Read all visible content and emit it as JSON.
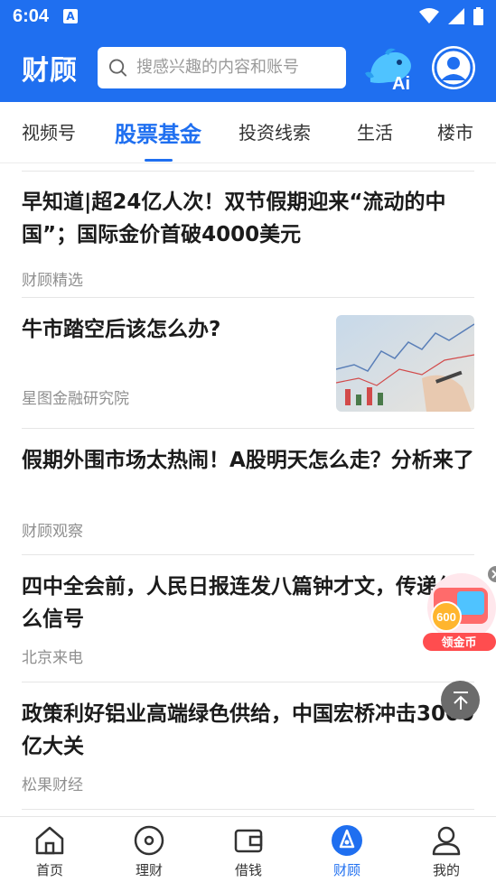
{
  "status_bar": {
    "time": "6:04",
    "a_badge": "A"
  },
  "header": {
    "brand": "财顾",
    "search_placeholder": "搜感兴趣的内容和账号",
    "ai_label": "Ai"
  },
  "tabs": [
    {
      "label": "视频号"
    },
    {
      "label": "股票基金",
      "active": true
    },
    {
      "label": "投资线索"
    },
    {
      "label": "生活"
    },
    {
      "label": "楼市"
    }
  ],
  "articles": [
    {
      "title": "早知道|超24亿人次！双节假期迎来“流动的中国”；国际金价首破4000美元",
      "source": "财顾精选"
    },
    {
      "title": "牛市踏空后该怎么办?",
      "source": "星图金融研究院",
      "has_thumbnail": true
    },
    {
      "title": "假期外围市场太热闹！A股明天怎么走？分析来了",
      "source": "财顾观察"
    },
    {
      "title": "四中全会前，人民日报连发八篇钟才文，传递什么信号",
      "source": "北京来电"
    },
    {
      "title": "政策利好铝业高端绿色供给，中国宏桥冲击3000亿大关",
      "source": "松果财经"
    }
  ],
  "float_badge": {
    "coin_value": "600",
    "label": "领金币"
  },
  "bottom_nav": [
    {
      "label": "首页",
      "icon": "home-icon"
    },
    {
      "label": "理财",
      "icon": "wealth-icon"
    },
    {
      "label": "借钱",
      "icon": "wallet-icon"
    },
    {
      "label": "财顾",
      "icon": "advisor-icon",
      "active": true
    },
    {
      "label": "我的",
      "icon": "profile-icon"
    }
  ],
  "colors": {
    "brand_blue": "#1f6ff0",
    "active_tab": "#1f6ff0"
  }
}
